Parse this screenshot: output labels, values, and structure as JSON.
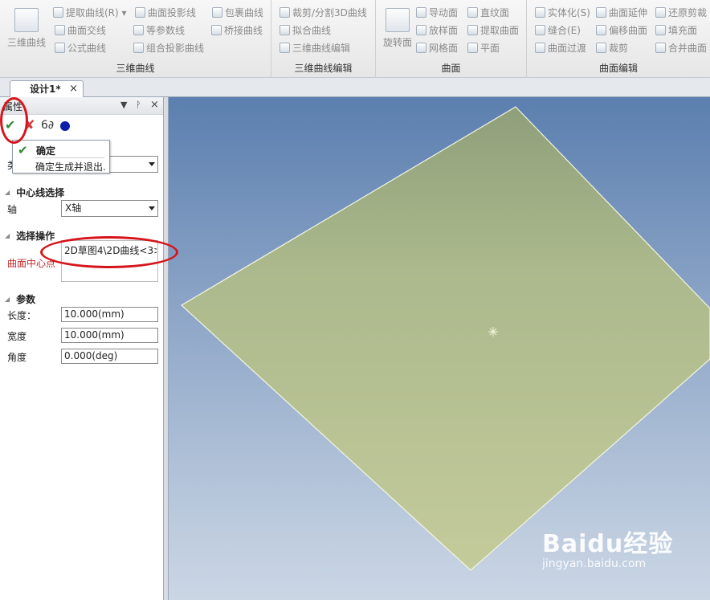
{
  "ribbon": {
    "groups": [
      {
        "label": "三维曲线",
        "big_button": "三维曲线",
        "items": [
          "提取曲线(R)",
          "曲面投影线",
          "包裹曲线",
          "曲面交线",
          "等参数线",
          "桥接曲线",
          "公式曲线",
          "组合投影曲线"
        ]
      },
      {
        "label": "三维曲线编辑",
        "items": [
          "裁剪/分割3D曲线",
          "拟合曲线",
          "三维曲线编辑"
        ]
      },
      {
        "label": "曲面",
        "big_button": "旋转面",
        "items": [
          "导动面",
          "直纹面",
          "放样面",
          "提取曲面",
          "网格面",
          "平面"
        ]
      },
      {
        "label": "曲面编辑",
        "items": [
          "实体化(S)",
          "曲面延伸",
          "还原剪裁",
          "缝合(E)",
          "偏移曲面",
          "填充面",
          "曲面过渡",
          "裁剪",
          "合并曲面"
        ]
      }
    ]
  },
  "tab": {
    "label": "设计1*",
    "close": "×"
  },
  "panel": {
    "title": "属性",
    "controls": {
      "dropdown": "▼",
      "pin": "ᚹ",
      "close": "×"
    },
    "tooltip": {
      "title": "确定",
      "description": "确定生成并退出."
    },
    "type_label": "类",
    "centerline_section": "中心线选择",
    "axis_label": "轴",
    "axis_value": "X轴",
    "select_section": "选择操作",
    "surface_center_label": "曲面中心点",
    "selection_value": "2D草图4\\2D曲线<3>_",
    "params_section": "参数",
    "length_label": "长度：",
    "length_value": "10.000(mm)",
    "width_label": "宽度",
    "width_value": "10.000(mm)",
    "angle_label": "角度",
    "angle_value": "0.000(deg)"
  },
  "watermark": {
    "logo": "Baidu经验",
    "url": "jingyan.baidu.com"
  },
  "colors": {
    "plane_fill": "#b6c490",
    "plane_edge": "#f2f6e0",
    "annotation_red": "#d6141b",
    "ok_green": "#2e8b2e"
  }
}
